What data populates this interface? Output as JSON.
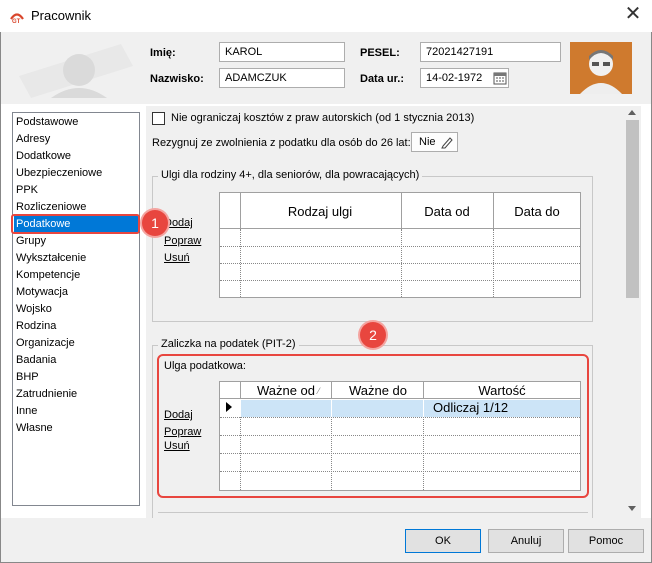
{
  "window": {
    "title": "Pracownik"
  },
  "header": {
    "imie_label": "Imię:",
    "imie_value": "KAROL",
    "nazwisko_label": "Nazwisko:",
    "nazwisko_value": "ADAMCZUK",
    "pesel_label": "PESEL:",
    "pesel_value": "72021427191",
    "data_ur_label": "Data ur.:",
    "data_ur_value": "14-02-1972"
  },
  "sidebar": {
    "items": [
      {
        "label": "Podstawowe"
      },
      {
        "label": "Adresy"
      },
      {
        "label": "Dodatkowe"
      },
      {
        "label": "Ubezpieczeniowe"
      },
      {
        "label": "PPK"
      },
      {
        "label": "Rozliczeniowe"
      },
      {
        "label": "Podatkowe"
      },
      {
        "label": "Grupy"
      },
      {
        "label": "Wykształcenie"
      },
      {
        "label": "Kompetencje"
      },
      {
        "label": "Motywacja"
      },
      {
        "label": "Wojsko"
      },
      {
        "label": "Rodzina"
      },
      {
        "label": "Organizacje"
      },
      {
        "label": "Badania"
      },
      {
        "label": "BHP"
      },
      {
        "label": "Zatrudnienie"
      },
      {
        "label": "Inne"
      },
      {
        "label": "Własne"
      }
    ],
    "selected": "Podatkowe"
  },
  "main": {
    "checkbox_label": "Nie ograniczaj kosztów z praw autorskich (od 1 stycznia 2013)",
    "zwolnienie_label": "Rezygnuj ze zwolnienia z podatku dla osób do 26 lat:",
    "zwolnienie_value": "Nie",
    "ulgi_group_title": "Ulgi dla rodziny 4+, dla seniorów, dla powracających)",
    "ulgi_actions": {
      "add": "Dodaj",
      "edit": "Popraw",
      "delete": "Usuń"
    },
    "ulgi_columns": [
      "Rodzaj ulgi",
      "Data od",
      "Data do"
    ],
    "zaliczka_group_title": "Zaliczka na podatek (PIT-2)",
    "ulga_podatkowa_label": "Ulga podatkowa:",
    "zaliczka_actions": {
      "add": "Dodaj",
      "edit": "Popraw",
      "delete": "Usuń"
    },
    "zaliczka_columns": [
      "Ważne od",
      "Ważne do",
      "Wartość"
    ],
    "zaliczka_rows": [
      {
        "wazne_od": "",
        "wazne_do": "",
        "wartosc": "Odliczaj 1/12"
      }
    ]
  },
  "annotations": {
    "badge1": "1",
    "badge2": "2",
    "accent_color": "#e8463f"
  },
  "footer": {
    "ok_label": "OK",
    "cancel_label": "Anuluj",
    "help_label": "Pomoc"
  }
}
